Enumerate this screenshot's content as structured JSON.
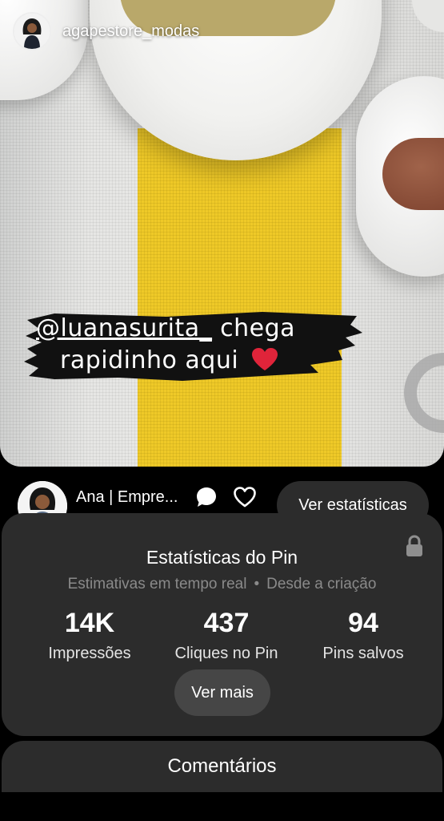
{
  "story": {
    "username": "agapestore_modas",
    "sticker_mention": "@luanasurita_",
    "sticker_line1_rest": " chega",
    "sticker_line2": "rapidinho aqui",
    "sticker_emoji": "❤️"
  },
  "pin": {
    "owner_name": "Ana | Empre...",
    "stats_button_label": "Ver estatísticas"
  },
  "stats_panel": {
    "title": "Estatísticas do Pin",
    "subtitle_left": "Estimativas em tempo real",
    "subtitle_sep": "•",
    "subtitle_right": "Desde a criação",
    "stats": [
      {
        "value": "14K",
        "label": "Impressões"
      },
      {
        "value": "437",
        "label": "Cliques no Pin"
      },
      {
        "value": "94",
        "label": "Pins salvos"
      }
    ],
    "more_button_label": "Ver mais"
  },
  "comments": {
    "label": "Comentários"
  },
  "icons": {
    "comment": "comment-icon",
    "heart": "heart-icon",
    "lock": "lock-icon"
  },
  "colors": {
    "panel_bg": "#2c2c2c",
    "button_bg": "#464646",
    "subtitle_text": "#8a8a8a",
    "heart_emoji": "#e0243a"
  }
}
